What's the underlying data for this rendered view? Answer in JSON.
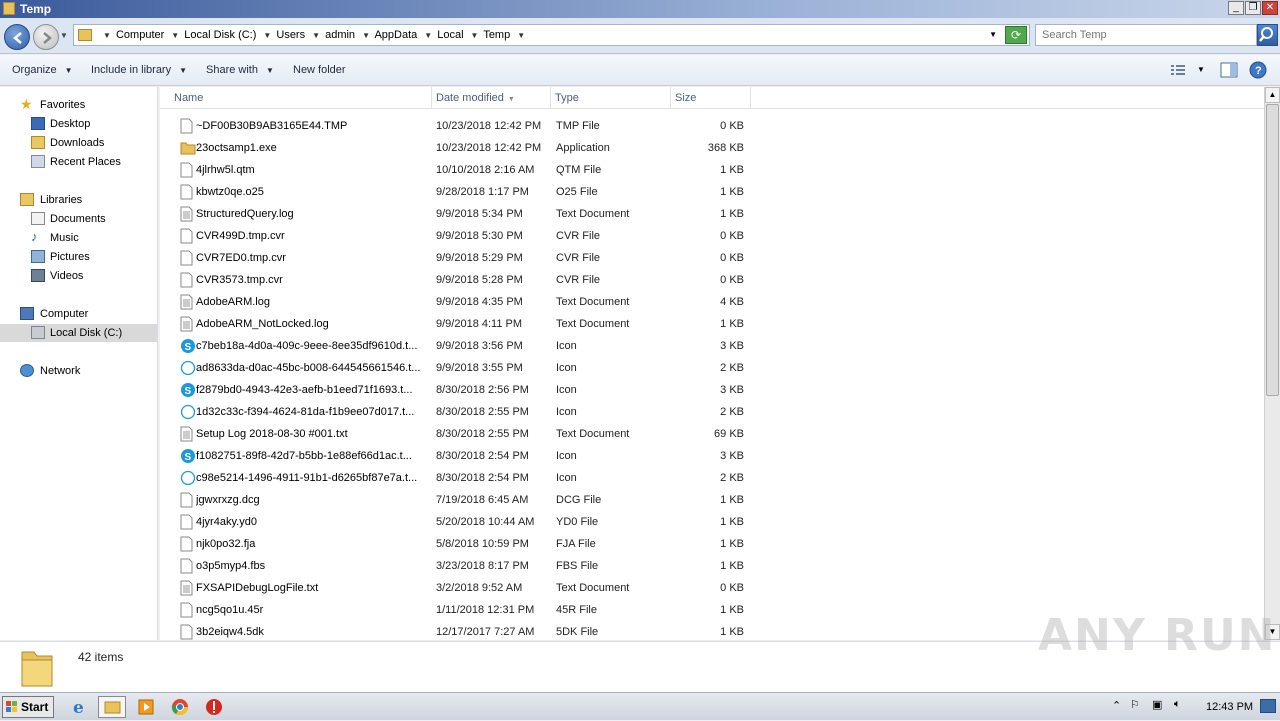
{
  "window": {
    "title": "Temp"
  },
  "address": {
    "crumbs": [
      "Computer",
      "Local Disk (C:)",
      "Users",
      "admin",
      "AppData",
      "Local",
      "Temp"
    ],
    "search_placeholder": "Search Temp"
  },
  "toolbar": {
    "organize": "Organize",
    "include_in_library": "Include in library",
    "share_with": "Share with",
    "new_folder": "New folder"
  },
  "sidebar": {
    "favorites": {
      "label": "Favorites",
      "items": [
        "Desktop",
        "Downloads",
        "Recent Places"
      ]
    },
    "libraries": {
      "label": "Libraries",
      "items": [
        "Documents",
        "Music",
        "Pictures",
        "Videos"
      ]
    },
    "computer": {
      "label": "Computer",
      "items": [
        "Local Disk (C:)"
      ]
    },
    "network": {
      "label": "Network"
    }
  },
  "columns": {
    "name": "Name",
    "date": "Date modified",
    "type": "Type",
    "size": "Size"
  },
  "files": [
    {
      "name": "~DF00B30B9AB3165E44.TMP",
      "date": "10/23/2018 12:42 PM",
      "type": "TMP File",
      "size": "0 KB",
      "icon": "file"
    },
    {
      "name": "23octsamp1.exe",
      "date": "10/23/2018 12:42 PM",
      "type": "Application",
      "size": "368 KB",
      "icon": "folder"
    },
    {
      "name": "4jlrhw5l.qtm",
      "date": "10/10/2018 2:16 AM",
      "type": "QTM File",
      "size": "1 KB",
      "icon": "file"
    },
    {
      "name": "kbwtz0qe.o25",
      "date": "9/28/2018 1:17 PM",
      "type": "O25 File",
      "size": "1 KB",
      "icon": "file"
    },
    {
      "name": "StructuredQuery.log",
      "date": "9/9/2018 5:34 PM",
      "type": "Text Document",
      "size": "1 KB",
      "icon": "text"
    },
    {
      "name": "CVR499D.tmp.cvr",
      "date": "9/9/2018 5:30 PM",
      "type": "CVR File",
      "size": "0 KB",
      "icon": "file"
    },
    {
      "name": "CVR7ED0.tmp.cvr",
      "date": "9/9/2018 5:29 PM",
      "type": "CVR File",
      "size": "0 KB",
      "icon": "file"
    },
    {
      "name": "CVR3573.tmp.cvr",
      "date": "9/9/2018 5:28 PM",
      "type": "CVR File",
      "size": "0 KB",
      "icon": "file"
    },
    {
      "name": "AdobeARM.log",
      "date": "9/9/2018 4:35 PM",
      "type": "Text Document",
      "size": "4 KB",
      "icon": "text"
    },
    {
      "name": "AdobeARM_NotLocked.log",
      "date": "9/9/2018 4:11 PM",
      "type": "Text Document",
      "size": "1 KB",
      "icon": "text"
    },
    {
      "name": "c7beb18a-4d0a-409c-9eee-8ee35df9610d.t...",
      "date": "9/9/2018 3:56 PM",
      "type": "Icon",
      "size": "3 KB",
      "icon": "skype"
    },
    {
      "name": "ad8633da-d0ac-45bc-b008-644545661546.t...",
      "date": "9/9/2018 3:55 PM",
      "type": "Icon",
      "size": "2 KB",
      "icon": "skype-outline"
    },
    {
      "name": "f2879bd0-4943-42e3-aefb-b1eed71f1693.t...",
      "date": "8/30/2018 2:56 PM",
      "type": "Icon",
      "size": "3 KB",
      "icon": "skype"
    },
    {
      "name": "1d32c33c-f394-4624-81da-f1b9ee07d017.t...",
      "date": "8/30/2018 2:55 PM",
      "type": "Icon",
      "size": "2 KB",
      "icon": "skype-outline"
    },
    {
      "name": "Setup Log 2018-08-30 #001.txt",
      "date": "8/30/2018 2:55 PM",
      "type": "Text Document",
      "size": "69 KB",
      "icon": "text"
    },
    {
      "name": "f1082751-89f8-42d7-b5bb-1e88ef66d1ac.t...",
      "date": "8/30/2018 2:54 PM",
      "type": "Icon",
      "size": "3 KB",
      "icon": "skype"
    },
    {
      "name": "c98e5214-1496-4911-91b1-d6265bf87e7a.t...",
      "date": "8/30/2018 2:54 PM",
      "type": "Icon",
      "size": "2 KB",
      "icon": "skype-outline"
    },
    {
      "name": "jgwxrxzg.dcg",
      "date": "7/19/2018 6:45 AM",
      "type": "DCG File",
      "size": "1 KB",
      "icon": "file"
    },
    {
      "name": "4jyr4aky.yd0",
      "date": "5/20/2018 10:44 AM",
      "type": "YD0 File",
      "size": "1 KB",
      "icon": "file"
    },
    {
      "name": "njk0po32.fja",
      "date": "5/8/2018 10:59 PM",
      "type": "FJA File",
      "size": "1 KB",
      "icon": "file"
    },
    {
      "name": "o3p5myp4.fbs",
      "date": "3/23/2018 8:17 PM",
      "type": "FBS File",
      "size": "1 KB",
      "icon": "file"
    },
    {
      "name": "FXSAPIDebugLogFile.txt",
      "date": "3/2/2018 9:52 AM",
      "type": "Text Document",
      "size": "0 KB",
      "icon": "text"
    },
    {
      "name": "ncg5qo1u.45r",
      "date": "1/11/2018 12:31 PM",
      "type": "45R File",
      "size": "1 KB",
      "icon": "file"
    },
    {
      "name": "3b2eiqw4.5dk",
      "date": "12/17/2017 7:27 AM",
      "type": "5DK File",
      "size": "1 KB",
      "icon": "file"
    }
  ],
  "details": {
    "item_count": "42 items"
  },
  "watermark": "ANY RUN",
  "taskbar": {
    "start": "Start",
    "clock": "12:43 PM"
  }
}
